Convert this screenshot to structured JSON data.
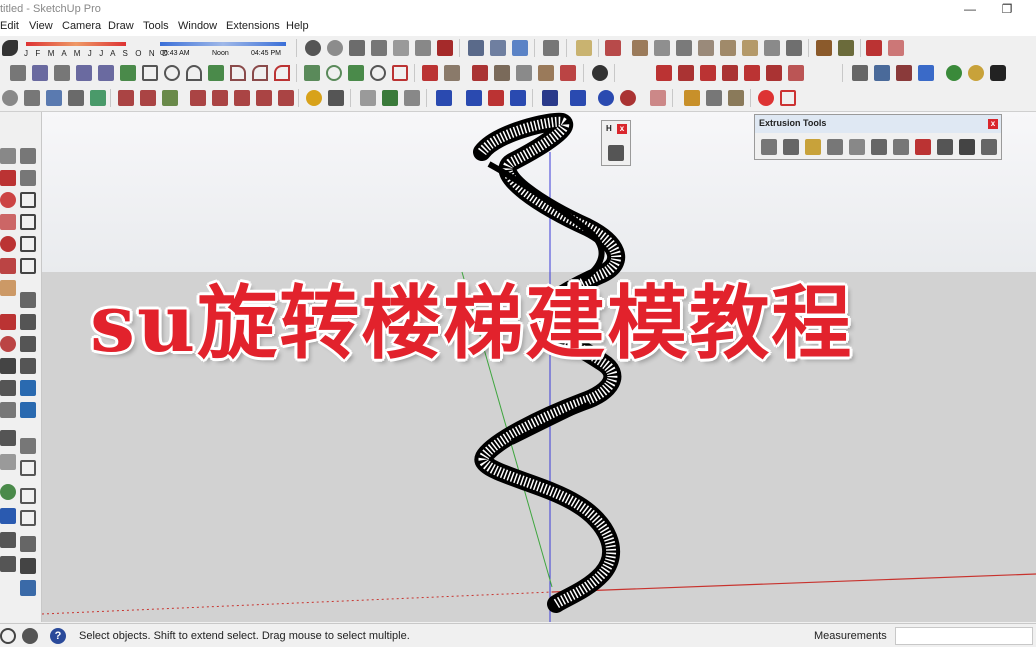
{
  "window": {
    "title": "titled - SketchUp Pro",
    "minimize_glyph": "—",
    "restore_glyph": "❐"
  },
  "menu": [
    "Edit",
    "View",
    "Camera",
    "Draw",
    "Tools",
    "Window",
    "Extensions",
    "Help"
  ],
  "shadow_settings": {
    "months": "J F M A M J J A S O N D",
    "time_start": "06:43 AM",
    "time_mid": "Noon",
    "time_end": "04:45 PM"
  },
  "floating_panel": {
    "label": "H",
    "close": "x"
  },
  "extrusion_panel": {
    "title": "Extrusion Tools",
    "close": "x"
  },
  "overlay": {
    "headline": "su旋转楼梯建模教程"
  },
  "statusbar": {
    "message": "Select objects. Shift to extend select. Drag mouse to select multiple.",
    "measurements_label": "Measurements",
    "measurements_value": "",
    "help_glyph": "?"
  },
  "colors": {
    "headline": "#e2222c",
    "axis_red": "#c8332e",
    "axis_green": "#3fa63f",
    "axis_blue": "#3a3ad8",
    "ground": "#d2d2d2",
    "sky": "#eceef1"
  }
}
